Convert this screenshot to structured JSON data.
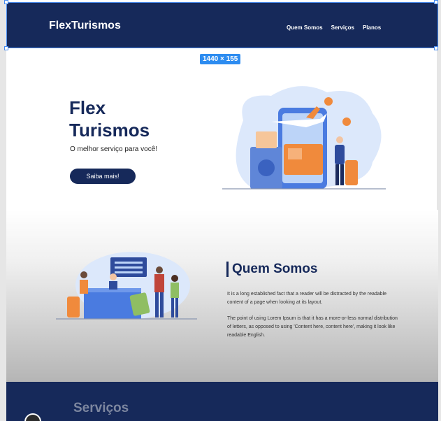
{
  "header": {
    "logo": "FlexTurismos",
    "nav": [
      "Quem Somos",
      "Serviços",
      "Planos"
    ]
  },
  "frame_badge": "1440 × 155",
  "hero": {
    "title": "Flex Turismos",
    "subtitle": "O melhor serviço para você!",
    "button": "Saiba mais!"
  },
  "about": {
    "title": "Quem Somos",
    "paragraphs": [
      "It is a long established fact that a reader will be distracted by the readable content of a page when looking at its layout.",
      "The point of using Lorem Ipsum is that it has a more-or-less normal distribution of letters, as opposed to using 'Content here, content here', making it look like readable English."
    ]
  },
  "services": {
    "title": "Serviços"
  },
  "colors": {
    "navy": "#16295a",
    "accent_orange": "#f08a3c",
    "accent_blue": "#4a7be0",
    "selection": "#2d8cf0"
  }
}
